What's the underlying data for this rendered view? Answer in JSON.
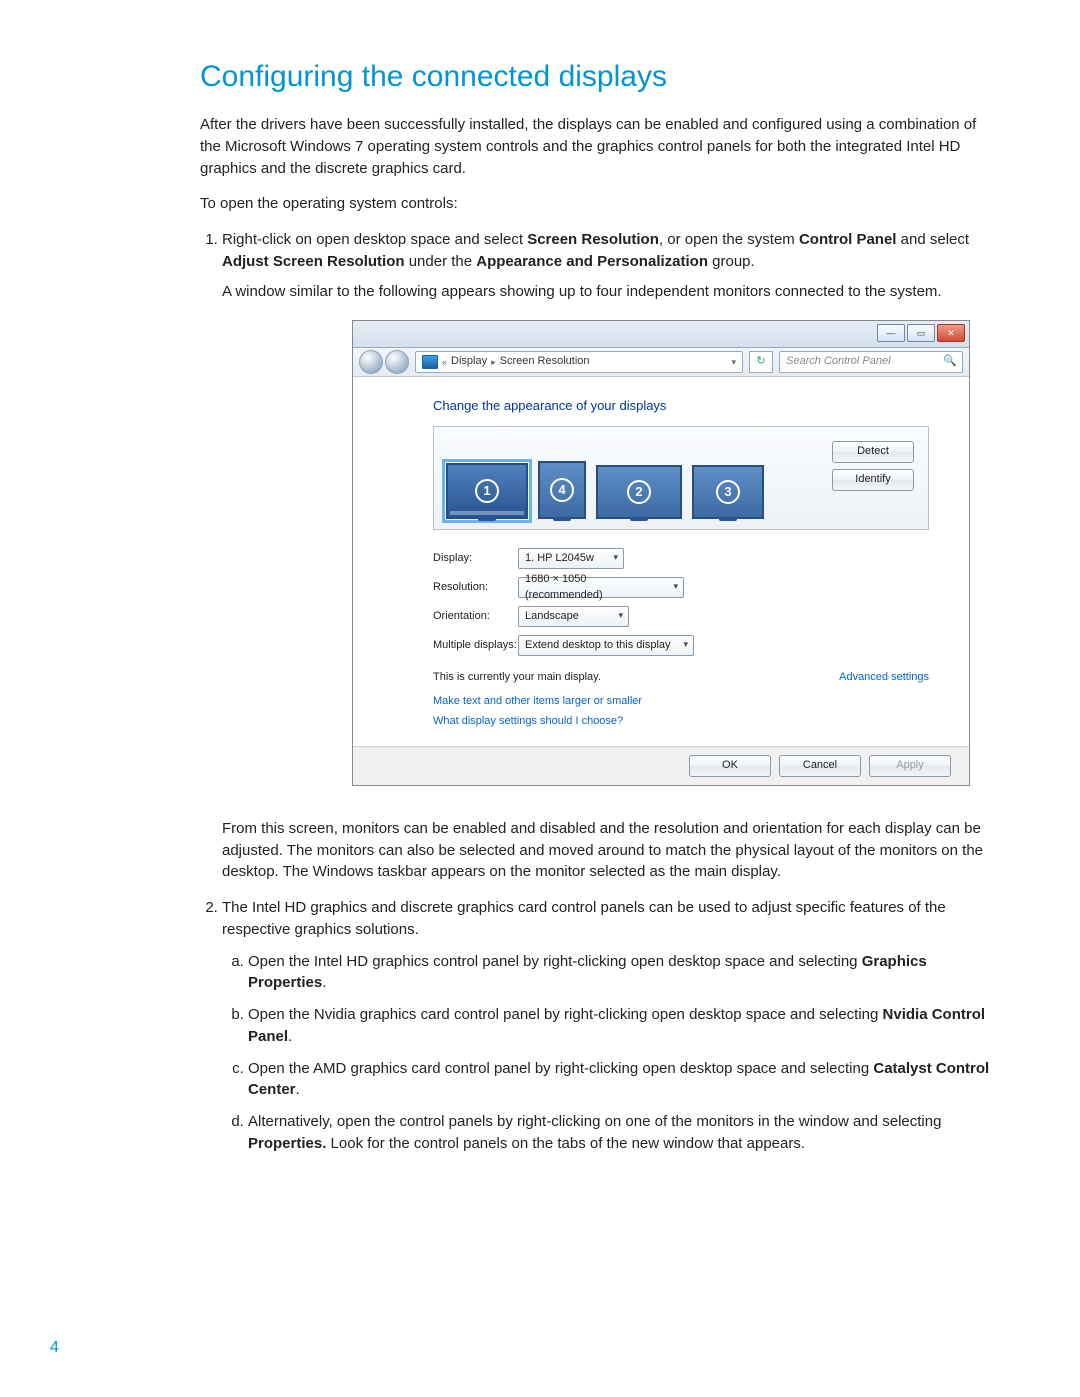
{
  "heading": "Configuring the connected displays",
  "intro": "After the drivers have been successfully installed, the displays can be enabled and configured using a combination of the Microsoft Windows 7 operating system controls and the graphics control panels for both the integrated Intel HD graphics and the discrete graphics card.",
  "open_controls": "To open the operating system controls:",
  "step1_pre": "Right-click on open desktop space and select ",
  "step1_b1": "Screen Resolution",
  "step1_mid1": ", or open the system ",
  "step1_b2": "Control Panel",
  "step1_mid2": " and select ",
  "step1_b3": "Adjust Screen Resolution",
  "step1_mid3": " under the ",
  "step1_b4": "Appearance and Personalization",
  "step1_end": " group.",
  "step1_after": "A window similar to the following appears showing up to four independent monitors connected to the system.",
  "after_figure": "From this screen, monitors can be enabled and disabled and the resolution and orientation for each display can be adjusted. The monitors can also be selected and moved around to match the physical layout of the monitors on the desktop. The Windows taskbar appears on the monitor selected as the main display.",
  "step2": "The Intel HD graphics and discrete graphics card control panels can be used to adjust specific features of the respective graphics solutions.",
  "step2a_pre": "Open the Intel HD graphics control panel by right-clicking open desktop space and selecting ",
  "step2a_b": "Graphics Properties",
  "step2a_end": ".",
  "step2b_pre": "Open the Nvidia graphics card control panel by right-clicking open desktop space and selecting ",
  "step2b_b": "Nvidia Control Panel",
  "step2b_end": ".",
  "step2c_pre": "Open the AMD graphics card control panel by right-clicking open desktop space and selecting ",
  "step2c_b": "Catalyst Control Center",
  "step2c_end": ".",
  "step2d_pre": "Alternatively, open the control panels by right-clicking on one of the monitors in the window and selecting ",
  "step2d_b": "Properties.",
  "step2d_end": " Look for the control panels on the tabs of the new window that appears.",
  "page_number": "4",
  "screenshot": {
    "breadcrumb_back": "«",
    "breadcrumb_display": "Display",
    "breadcrumb_sep": "▸",
    "breadcrumb_current": "Screen Resolution",
    "refresh_glyph": "↻",
    "search_placeholder": "Search Control Panel",
    "search_glyph": "🔍",
    "panel_heading": "Change the appearance of your displays",
    "monitors": {
      "m1": "1",
      "m2": "2",
      "m3": "3",
      "m4": "4"
    },
    "detect": "Detect",
    "identify": "Identify",
    "labels": {
      "display": "Display:",
      "resolution": "Resolution:",
      "orientation": "Orientation:",
      "multiple": "Multiple displays:"
    },
    "values": {
      "display": "1. HP L2045w",
      "resolution": "1680 × 1050 (recommended)",
      "orientation": "Landscape",
      "multiple": "Extend desktop to this display"
    },
    "main_display_note": "This is currently your main display.",
    "advanced": "Advanced settings",
    "help1": "Make text and other items larger or smaller",
    "help2": "What display settings should I choose?",
    "ok": "OK",
    "cancel": "Cancel",
    "apply": "Apply",
    "min": "—",
    "max": "▭",
    "close": "✕"
  }
}
